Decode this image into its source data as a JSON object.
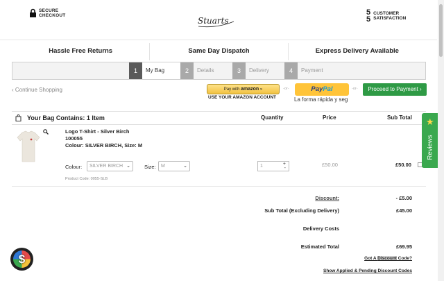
{
  "header": {
    "secure_line1": "SECURE",
    "secure_line2": "CHECKOUT",
    "logo_text": "Stuarts",
    "satisfaction_fraction_top": "5",
    "satisfaction_fraction_bottom": "5",
    "satisfaction_line1": "CUSTOMER",
    "satisfaction_line2": "SATISFACTION"
  },
  "features": [
    "Hassle Free Returns",
    "Same Day Dispatch",
    "Express Delivery Available"
  ],
  "steps": [
    {
      "num": "1",
      "label": "My Bag",
      "active": true
    },
    {
      "num": "2",
      "label": "Details",
      "active": false
    },
    {
      "num": "3",
      "label": "Delivery",
      "active": false
    },
    {
      "num": "4",
      "label": "Payment",
      "active": false
    }
  ],
  "actions": {
    "continue": "‹ Continue Shopping",
    "amazon_pay_prefix": "Pay with",
    "amazon_pay_brand": "amazon",
    "amazon_pay_arrows": "»",
    "amazon_sub": "USE YOUR AMAZON ACCOUNT",
    "or": "-or-",
    "paypal_part1": "Pay",
    "paypal_part2": "Pal",
    "paypal_sub": "La forma rápida y seg",
    "proceed": "Proceed to Payment ›"
  },
  "table": {
    "title": "Your Bag Contains: 1 Item",
    "col_quantity": "Quantity",
    "col_price": "Price",
    "col_subtotal": "Sub Total"
  },
  "item": {
    "name": "Logo T-Shirt - Silver Birch",
    "sku": "100055",
    "colour_size": "Colour: SILVER BIRCH, Size: M",
    "colour_label": "Colour:",
    "colour_value": "SILVER BIRCH",
    "size_label": "Size:",
    "size_value": "M",
    "product_code": "Product Code: 0055-SLB",
    "quantity": "1",
    "price": "£50.00",
    "subtotal": "£50.00"
  },
  "summary": {
    "discount_label": "Discount:",
    "discount_value": "- £5.00",
    "subtotal_label": "Sub Total (Excluding Delivery)",
    "subtotal_value": "£45.00",
    "delivery_label": "Delivery Costs",
    "estimated_label": "Estimated Total",
    "estimated_value": "£69.95",
    "got_code_pre": "Got A ",
    "got_code_hl": "Discount",
    "got_code_post": " Code?",
    "show_codes": "Show Applied & Pending Discount Codes"
  },
  "reviews": {
    "label": "Reviews",
    "star": "★"
  },
  "badge": {
    "symbol": "$"
  },
  "colors": {
    "proceed": "#2e9a45",
    "reviews": "#3aa84e",
    "paypal": "#ffc439",
    "amazon": "#f1c242"
  }
}
